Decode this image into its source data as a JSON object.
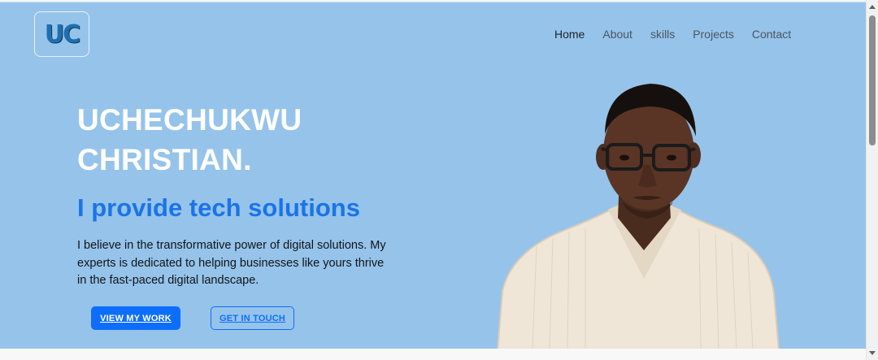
{
  "brand": {
    "logo_text": "UC"
  },
  "nav": {
    "items": [
      {
        "label": "Home",
        "active": true
      },
      {
        "label": "About",
        "active": false
      },
      {
        "label": "skills",
        "active": false
      },
      {
        "label": "Projects",
        "active": false
      },
      {
        "label": "Contact",
        "active": false
      }
    ]
  },
  "hero": {
    "name_line1": "UCHECHUKWU",
    "name_line2": "CHRISTIAN.",
    "tagline": "I provide tech solutions",
    "description": "I believe in the transformative power of digital solutions. My experts is dedicated to helping businesses like yours thrive in the fast-paced digital landscape.",
    "primary_button": "VIEW MY WORK",
    "secondary_button": "GET IN TOUCH",
    "portrait_icon": "person-portrait"
  },
  "colors": {
    "hero_background": "#96c3ea",
    "accent": "#0d6efd",
    "tagline": "#1a74e8"
  }
}
